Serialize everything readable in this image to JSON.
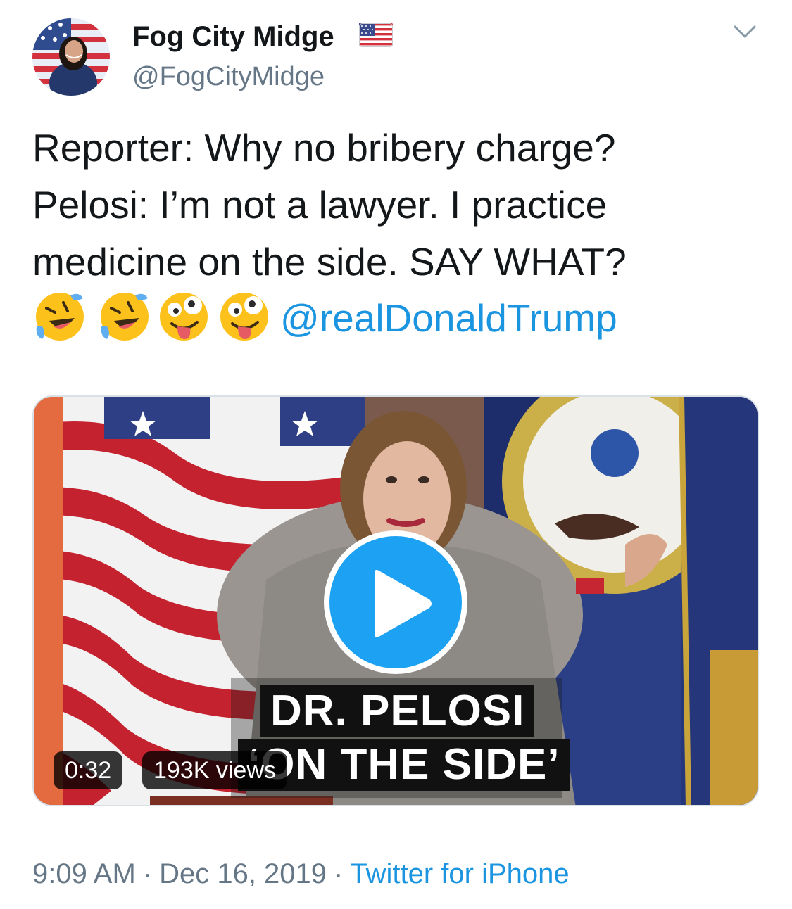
{
  "author": {
    "display_name": "Fog City Midge",
    "handle": "@FogCityMidge",
    "flag_icon": "us-flag-emoji"
  },
  "tweet": {
    "lines": [
      "Reporter: Why no bribery charge?",
      "Pelosi: I’m not a lawyer. I practice",
      "medicine on the side. SAY WHAT?"
    ],
    "emojis": [
      "rolling-on-floor-laughing",
      "rolling-on-floor-laughing",
      "zany-face",
      "zany-face"
    ],
    "mention": "@realDonaldTrump"
  },
  "video": {
    "caption_line1": "DR. PELOSI",
    "caption_line2": "‘ON THE SIDE’",
    "duration": "0:32",
    "views": "193K views",
    "play_icon": "play-icon"
  },
  "meta": {
    "time": "9:09 AM",
    "separator": "·",
    "date": "Dec 16, 2019",
    "source": "Twitter for iPhone"
  },
  "colors": {
    "link": "#1b95e0",
    "secondary_text": "#657786",
    "play_button": "#1da1f2"
  }
}
